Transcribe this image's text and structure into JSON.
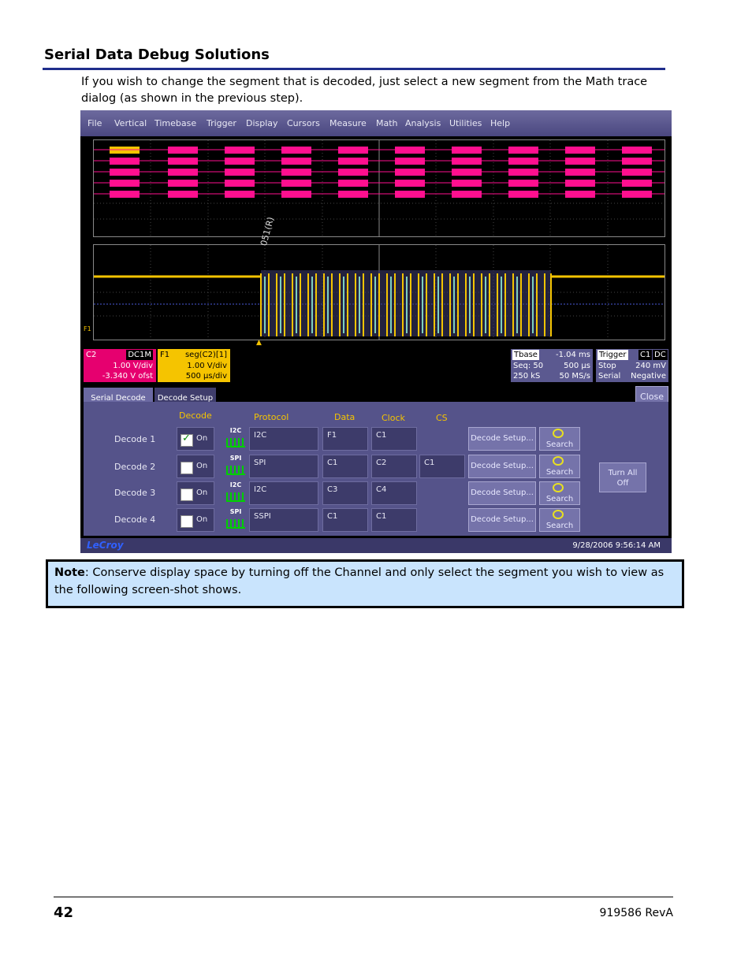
{
  "heading": "Serial Data Debug Solutions",
  "intro": "If you wish to change the segment that is decoded, just select a new segment from the Math trace dialog (as shown in the previous step).",
  "scope": {
    "menu": [
      "File",
      "Vertical",
      "Timebase",
      "Trigger",
      "Display",
      "Cursors",
      "Measure",
      "Math",
      "Analysis",
      "Utilities",
      "Help"
    ],
    "segment_label": "051(R)",
    "trace_marker": "F1",
    "trigger_marker": "▲",
    "c2": {
      "name": "C2",
      "coupling": "DC1M",
      "vdiv": "1.00 V/div",
      "offset": "-3.340 V ofst"
    },
    "f1": {
      "name": "F1",
      "func": "seg(C2)[1]",
      "vdiv": "1.00 V/div",
      "tdiv": "500 µs/div"
    },
    "timebase": {
      "label": "Tbase",
      "delay": "-1.04 ms",
      "seq": "Seq: 50",
      "tdiv": "500 µs",
      "samples": "250 kS",
      "rate": "50 MS/s"
    },
    "trigger": {
      "label": "Trigger",
      "src": "C1",
      "coupling": "DC",
      "mode": "Stop",
      "level": "240 mV",
      "type": "Serial",
      "slope": "Negative"
    },
    "tabs": [
      "Serial Decode",
      "Decode Setup"
    ],
    "close": "Close",
    "columns": {
      "decode": "Decode",
      "protocol": "Protocol",
      "data": "Data",
      "clock": "Clock",
      "cs": "CS"
    },
    "rows": [
      {
        "label": "Decode 1",
        "checked": true,
        "on": "On",
        "icon": "I2C",
        "protocol": "I2C",
        "data": "F1",
        "clock": "C1",
        "cs": ""
      },
      {
        "label": "Decode 2",
        "checked": false,
        "on": "On",
        "icon": "SPI",
        "protocol": "SPI",
        "data": "C1",
        "clock": "C2",
        "cs": "C1"
      },
      {
        "label": "Decode 3",
        "checked": false,
        "on": "On",
        "icon": "I2C",
        "protocol": "I2C",
        "data": "C3",
        "clock": "C4",
        "cs": ""
      },
      {
        "label": "Decode 4",
        "checked": false,
        "on": "On",
        "icon": "SPI",
        "protocol": "SSPI",
        "data": "C1",
        "clock": "C1",
        "cs": ""
      }
    ],
    "decode_setup": "Decode Setup...",
    "search": "Search",
    "turn_all_off": "Turn All Off",
    "brand": "LeCroy",
    "timestamp": "9/28/2006 9:56:14 AM",
    "colors": {
      "c2": "#e6006f",
      "f1": "#f5c400",
      "panel": "#55538a"
    }
  },
  "note": {
    "bold": "Note",
    "text": ": Conserve display space by turning off the Channel and only select the segment you wish to view as the following screen-shot shows."
  },
  "footer": {
    "page": "42",
    "doc": "919586 RevA"
  }
}
